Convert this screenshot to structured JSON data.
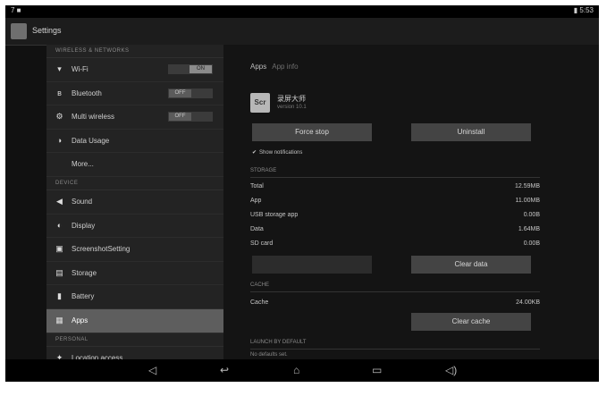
{
  "window": {
    "title": "Settings",
    "status_left": "7 ■",
    "status_right": "▮ 5:53"
  },
  "sidebar": {
    "section_top": "WIRELESS & NETWORKS",
    "network_items": [
      {
        "icon": "wifi-icon",
        "glyph": "▾",
        "label": "Wi-Fi",
        "toggle": "ON"
      },
      {
        "icon": "bluetooth-icon",
        "glyph": "ʙ",
        "label": "Bluetooth",
        "toggle": "OFF"
      },
      {
        "icon": "multi-wireless-icon",
        "glyph": "⚙",
        "label": "Multi wireless",
        "toggle": "OFF"
      },
      {
        "icon": "data-usage-icon",
        "glyph": "◑",
        "label": "Data Usage"
      },
      {
        "icon": "",
        "glyph": "",
        "label": "More..."
      }
    ],
    "section_device": "DEVICE",
    "device_items": [
      {
        "icon": "sound-icon",
        "glyph": "◀",
        "label": "Sound"
      },
      {
        "icon": "display-icon",
        "glyph": "◐",
        "label": "Display"
      },
      {
        "icon": "screenshot-icon",
        "glyph": "▣",
        "label": "ScreenshotSetting"
      },
      {
        "icon": "storage-icon",
        "glyph": "▤",
        "label": "Storage"
      },
      {
        "icon": "battery-icon",
        "glyph": "▮",
        "label": "Battery"
      },
      {
        "icon": "apps-icon",
        "glyph": "▦",
        "label": "Apps"
      }
    ],
    "section_personal": "PERSONAL",
    "personal_items": [
      {
        "icon": "location-icon",
        "glyph": "✦",
        "label": "Location access"
      }
    ]
  },
  "content": {
    "breadcrumb": "Apps",
    "breadcrumb_sub": "App info",
    "app": {
      "name": "录屏大师",
      "version": "version 10.1",
      "icon_text": "Scr"
    },
    "force_stop": "Force stop",
    "uninstall": "Uninstall",
    "show_notifications": "Show notifications",
    "storage_header": "STORAGE",
    "storage_rows": [
      {
        "label": "Total",
        "value": "12.59MB"
      },
      {
        "label": "App",
        "value": "11.00MB"
      },
      {
        "label": "USB storage app",
        "value": "0.00B"
      },
      {
        "label": "Data",
        "value": "1.64MB"
      },
      {
        "label": "SD card",
        "value": "0.00B"
      }
    ],
    "clear_data": "Clear data",
    "cache_header": "CACHE",
    "cache_label": "Cache",
    "cache_value": "24.00KB",
    "clear_cache": "Clear cache",
    "launch_header": "LAUNCH BY DEFAULT",
    "launch_sub": "No defaults set."
  }
}
